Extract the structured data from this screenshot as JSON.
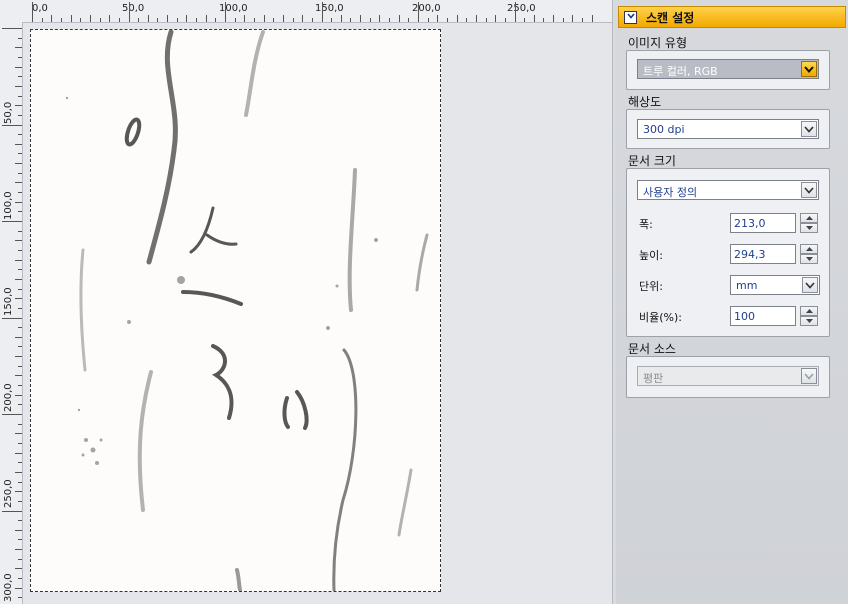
{
  "ruler": {
    "h_labels": [
      "0,0",
      "50,0",
      "100,0",
      "150,0",
      "200,0",
      "250,0"
    ],
    "v_labels": [
      "50,0",
      "100,0",
      "150,0",
      "200,0",
      "250,0",
      "300,0"
    ]
  },
  "panel": {
    "title": "스캔 설정",
    "image_type": {
      "label": "이미지 유형",
      "value": "트루 컬러, RGB"
    },
    "resolution": {
      "label": "해상도",
      "value": "300 dpi"
    },
    "doc_size": {
      "label": "문서 크기",
      "preset": "사용자 정의",
      "width_label": "폭:",
      "width_value": "213,0",
      "height_label": "높이:",
      "height_value": "294,3",
      "unit_label": "단위:",
      "unit_value": "mm",
      "ratio_label": "비율(%):",
      "ratio_value": "100"
    },
    "doc_source": {
      "label": "문서 소스",
      "value": "평판"
    }
  },
  "colors": {
    "accent": "#f3a900",
    "value_text": "#1f3f8f",
    "ink": "#5a5656"
  }
}
